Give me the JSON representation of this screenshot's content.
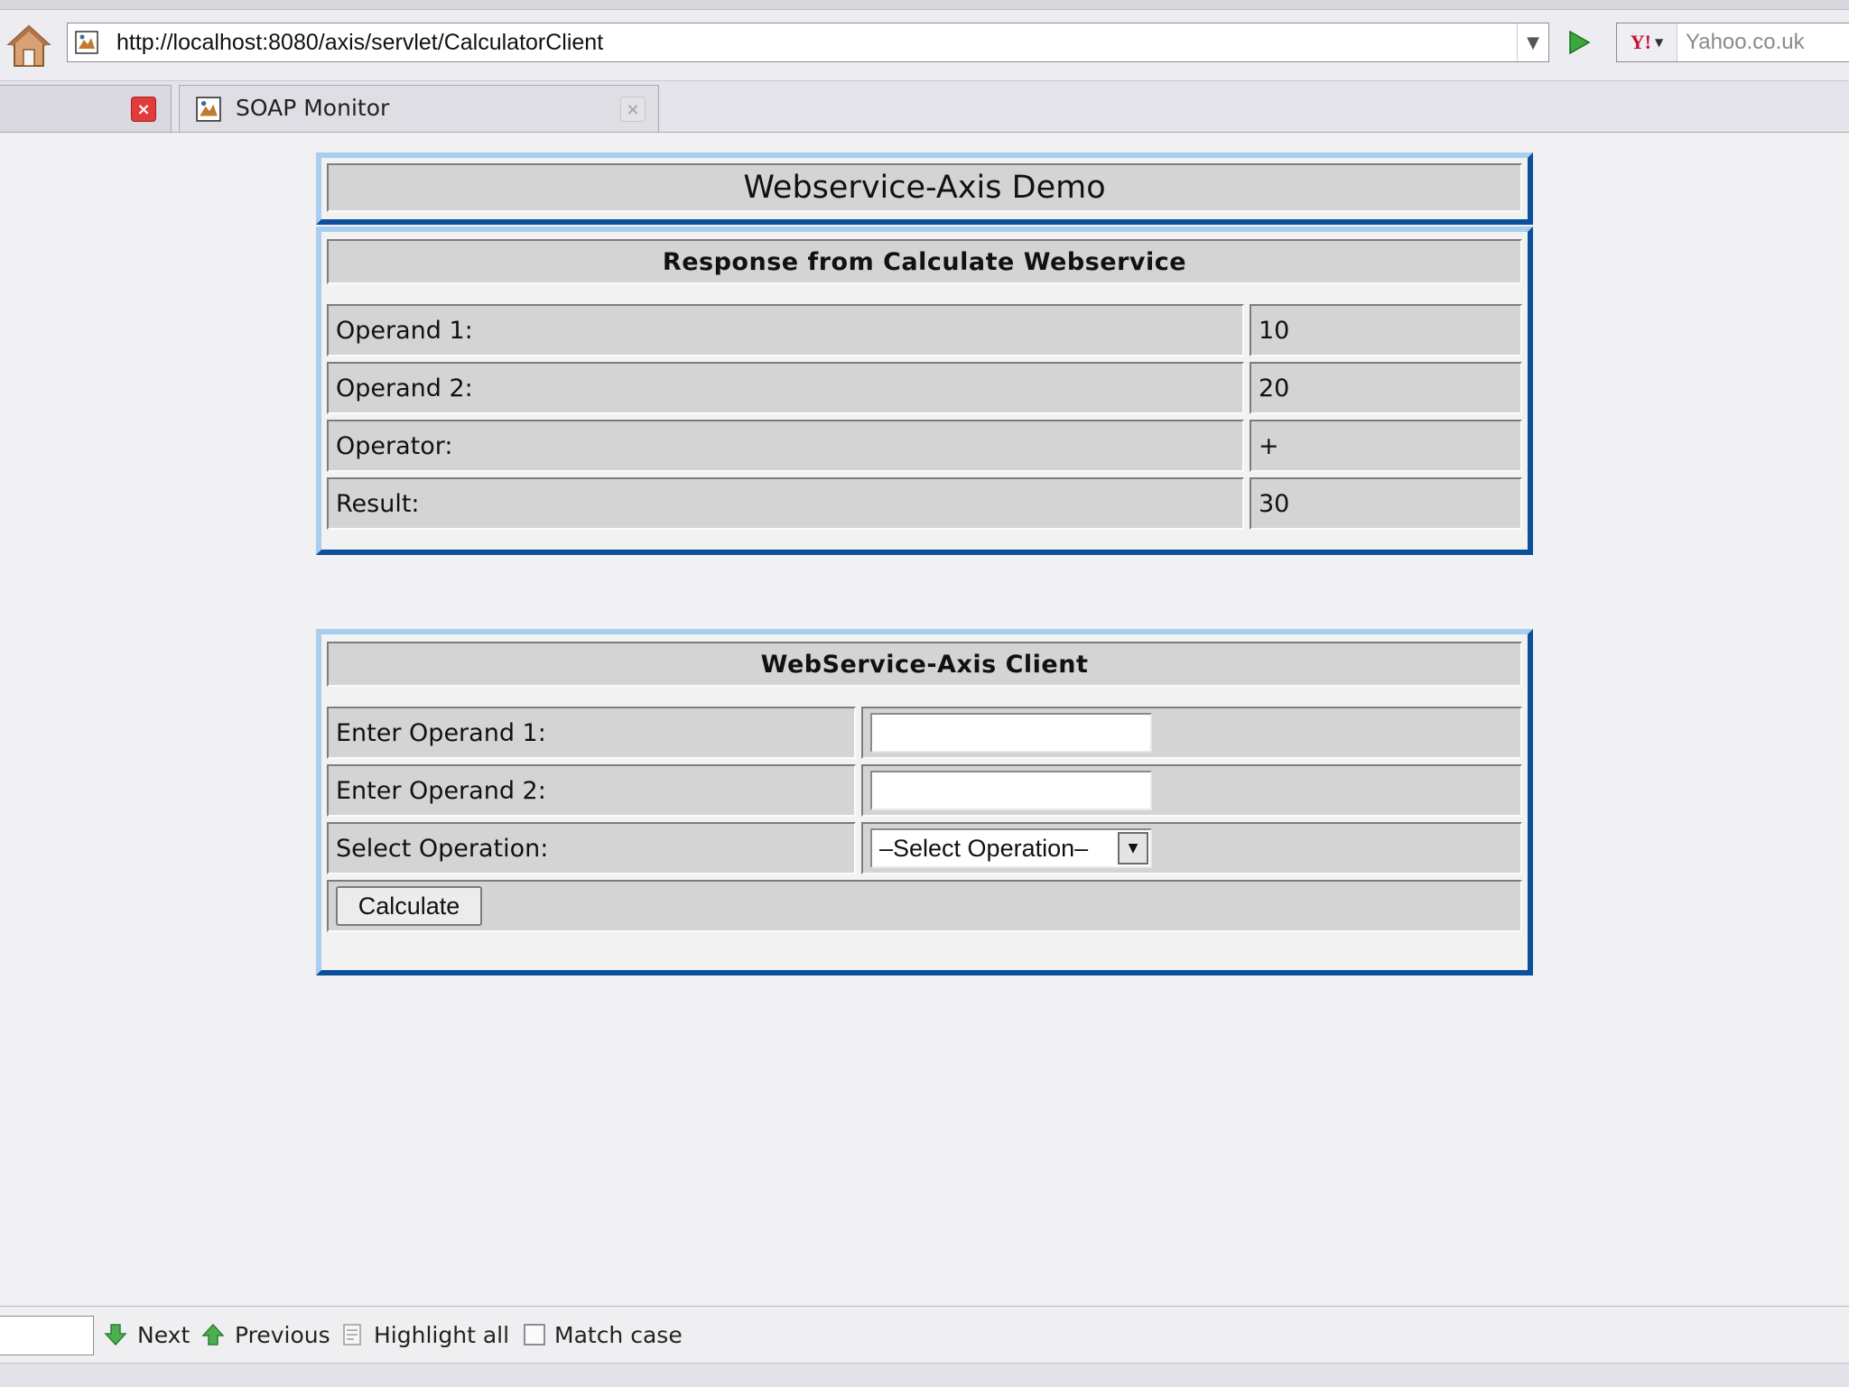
{
  "browser": {
    "url": "http://localhost:8080/axis/servlet/CalculatorClient",
    "search_placeholder": "Yahoo.co.uk",
    "search_engine_logo": "Y!",
    "tabs": [
      {
        "label": ""
      },
      {
        "label": "SOAP Monitor"
      }
    ]
  },
  "page": {
    "title": "Webservice-Axis Demo",
    "response": {
      "heading": "Response from Calculate Webservice",
      "rows": [
        {
          "label": "Operand 1:",
          "value": "10"
        },
        {
          "label": "Operand 2:",
          "value": "20"
        },
        {
          "label": "Operator:",
          "value": "+"
        },
        {
          "label": "Result:",
          "value": "30"
        }
      ]
    },
    "client": {
      "heading": "WebService-Axis Client",
      "operand1_label": "Enter Operand 1:",
      "operand1_value": "",
      "operand2_label": "Enter Operand 2:",
      "operand2_value": "",
      "operation_label": "Select Operation:",
      "operation_selected": "–Select Operation–",
      "calculate_label": "Calculate"
    }
  },
  "findbar": {
    "next_label": "Next",
    "previous_label": "Previous",
    "highlight_label": "Highlight all",
    "matchcase_label": "Match case"
  },
  "colors": {
    "panel_light_edge": "#a9cdf0",
    "panel_dark_edge": "#0c4f9a",
    "cell_bg": "#d4d4d4"
  }
}
